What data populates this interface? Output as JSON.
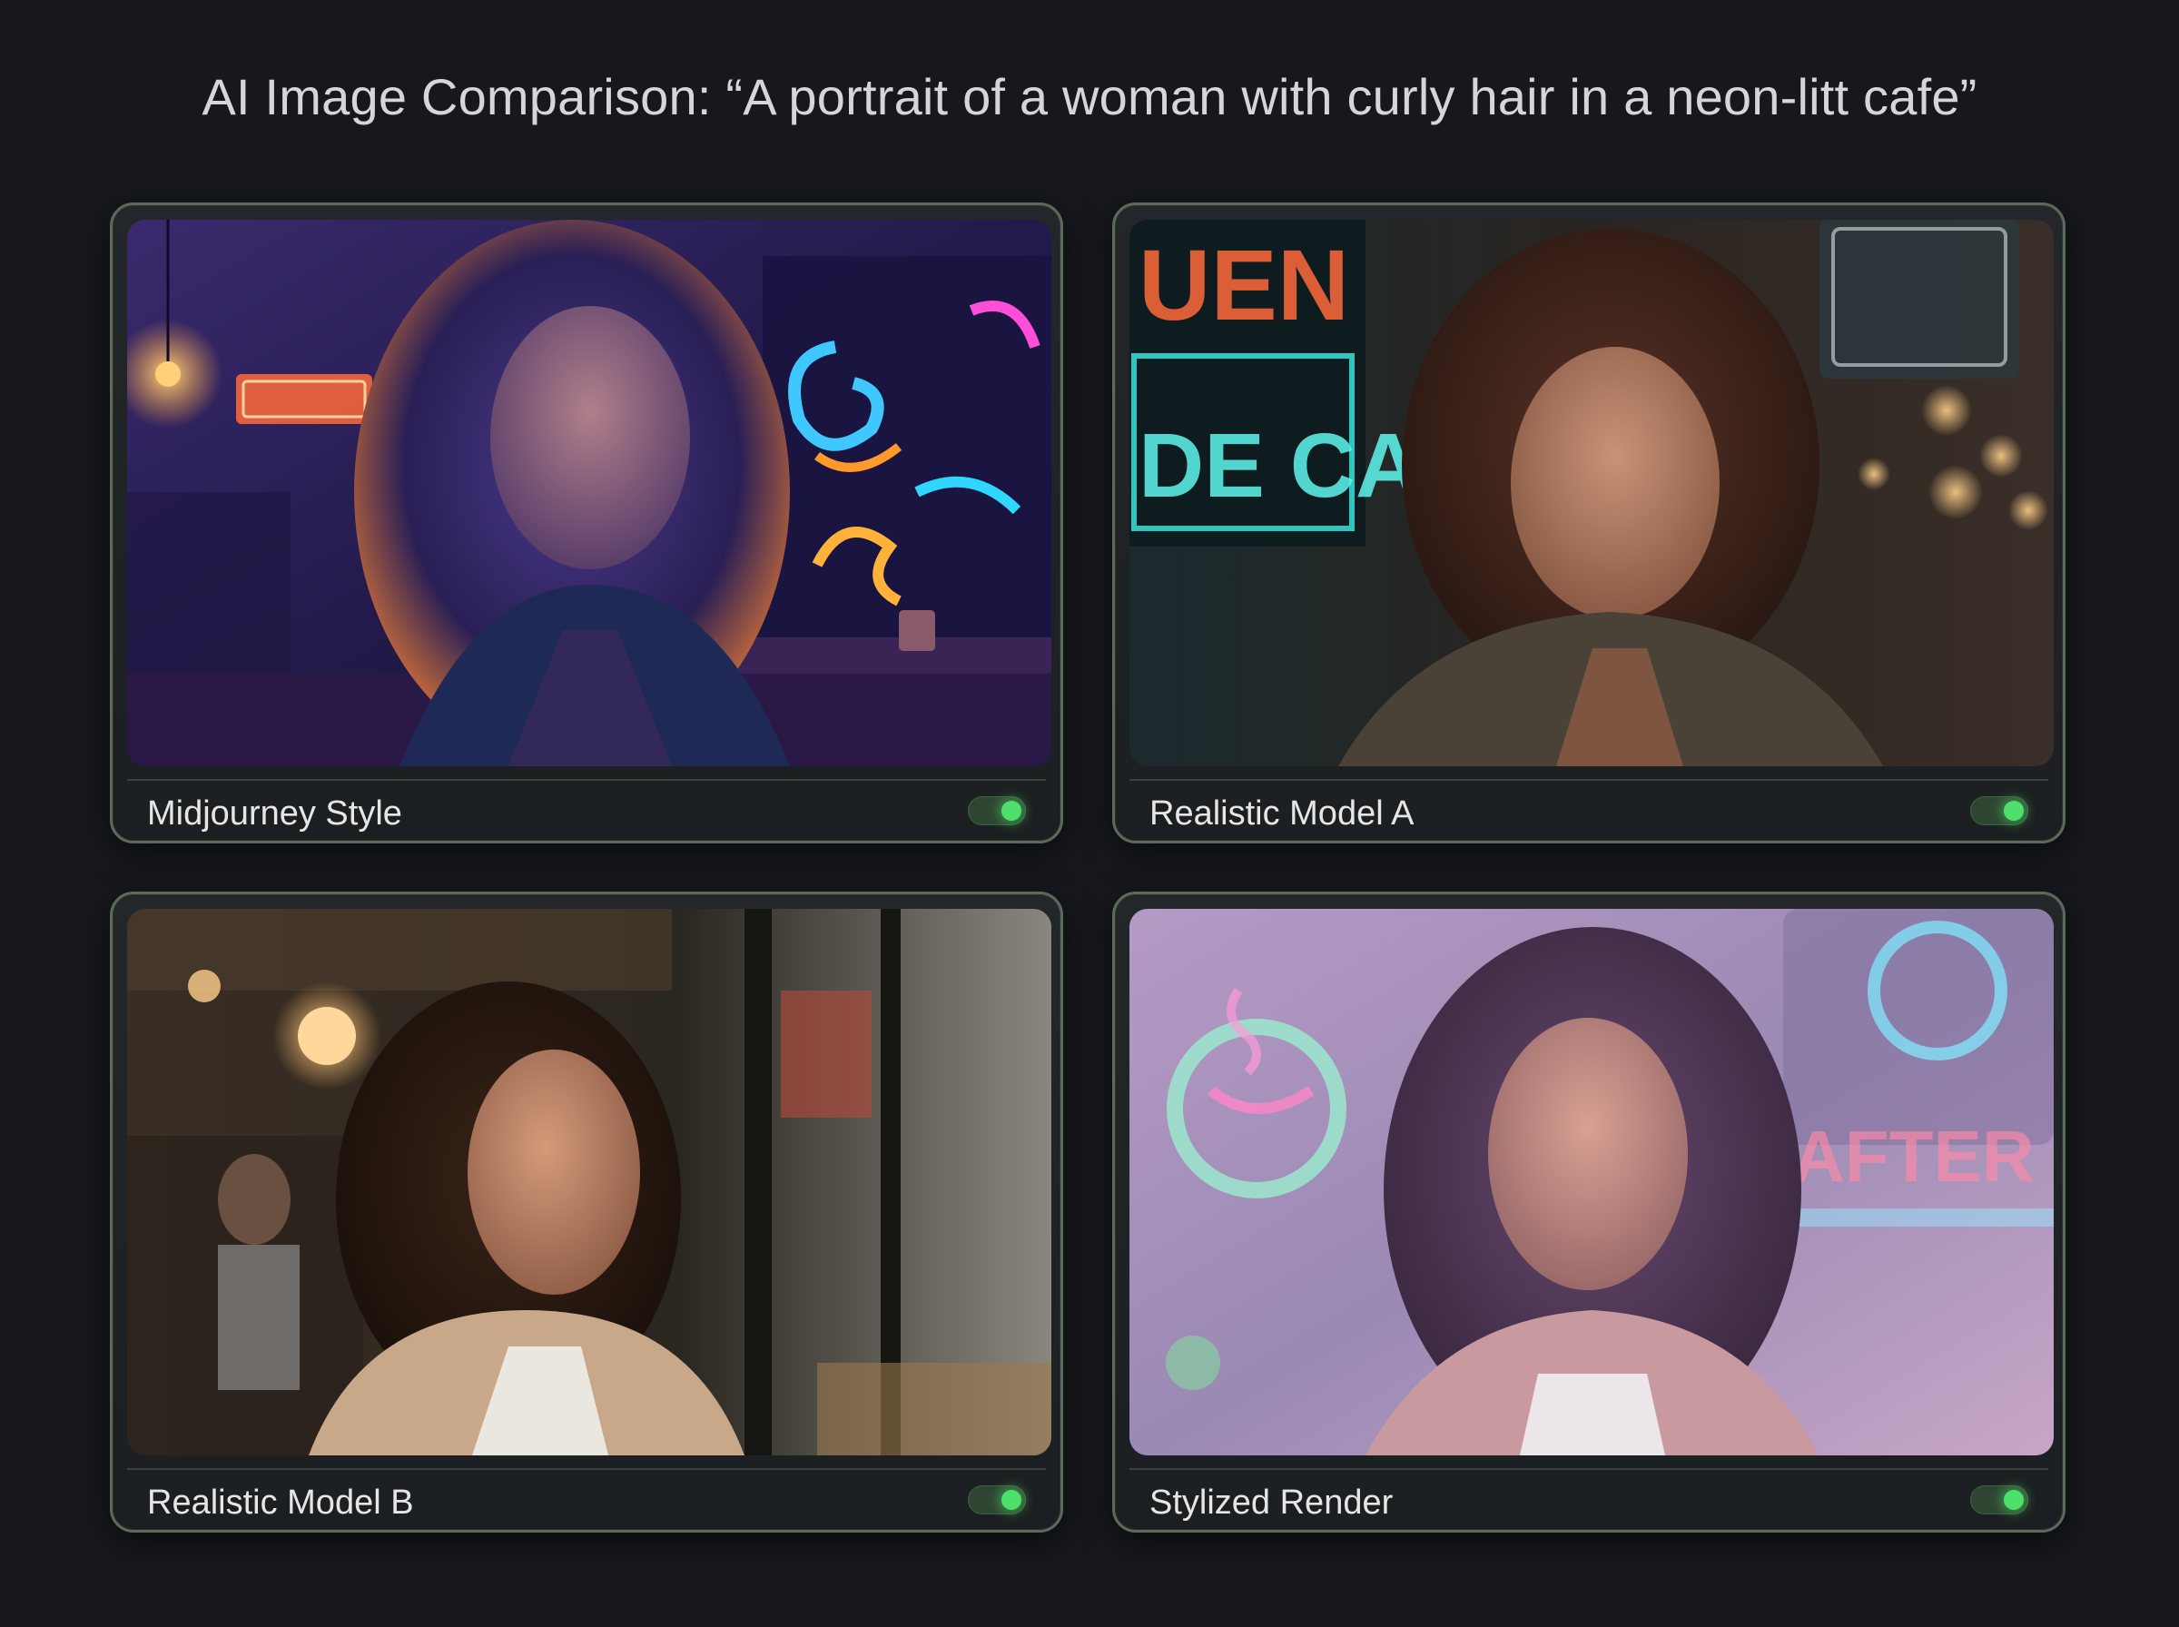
{
  "page": {
    "title": "AI Image Comparison: “A portrait of a woman with curly hair in a neon-litt cafe”"
  },
  "cards": [
    {
      "label": "Midjourney Style",
      "toggle_on": true
    },
    {
      "label": "Realistic Model A",
      "toggle_on": true
    },
    {
      "label": "Realistic Model B",
      "toggle_on": true
    },
    {
      "label": "Stylized Render",
      "toggle_on": true
    }
  ],
  "colors": {
    "background": "#17181d",
    "card_border": "#5c6a5c",
    "toggle_on": "#4fe06c"
  }
}
